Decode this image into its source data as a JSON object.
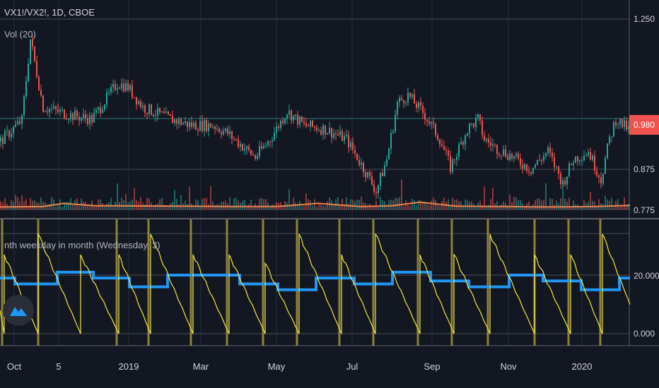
{
  "header": {
    "symbol_title": "VX1!/VX2!, 1D, CBOE",
    "volume_label": "Vol (20)"
  },
  "indicator": {
    "title": "nth weekday in month (Wednesday, 3)"
  },
  "price_axis": {
    "ticks": [
      "1.250",
      "0.875",
      "0.775"
    ],
    "last_price": "0.980"
  },
  "indicator_axis": {
    "ticks": [
      "20.000",
      "0.000"
    ]
  },
  "x_axis": {
    "labels": [
      "Oct",
      "5",
      "2019",
      "Mar",
      "May",
      "Jul",
      "Sep",
      "Nov",
      "2020"
    ]
  },
  "colors": {
    "up": "#26a69a",
    "down": "#ef5350",
    "vol_ma": "#e8844a",
    "saw": "#f5e642",
    "step": "#2196f3",
    "reset": "#b5a642",
    "badge": "#ef5350"
  },
  "chart_data": [
    {
      "type": "candlestick",
      "title": "VX1!/VX2!, 1D, CBOE",
      "ylim": [
        0.76,
        1.29
      ],
      "yticks": [
        1.25,
        0.875,
        0.775
      ],
      "close_anchors": [
        [
          0,
          0.945
        ],
        [
          10,
          0.998
        ],
        [
          14,
          1.2
        ],
        [
          20,
          1.03
        ],
        [
          33,
          1.01
        ],
        [
          43,
          1.0
        ],
        [
          55,
          1.09
        ],
        [
          60,
          1.08
        ],
        [
          67,
          1.03
        ],
        [
          80,
          1.0
        ],
        [
          90,
          0.985
        ],
        [
          100,
          0.985
        ],
        [
          107,
          0.965
        ],
        [
          120,
          0.905
        ],
        [
          127,
          0.95
        ],
        [
          135,
          1.02
        ],
        [
          143,
          0.985
        ],
        [
          153,
          0.975
        ],
        [
          163,
          0.95
        ],
        [
          173,
          0.86
        ],
        [
          177,
          0.82
        ],
        [
          182,
          0.9
        ],
        [
          187,
          1.04
        ],
        [
          192,
          1.06
        ],
        [
          200,
          1.01
        ],
        [
          207,
          0.95
        ],
        [
          212,
          0.88
        ],
        [
          220,
          0.975
        ],
        [
          225,
          1.0
        ],
        [
          228,
          0.95
        ],
        [
          233,
          0.93
        ],
        [
          240,
          0.91
        ],
        [
          250,
          0.875
        ],
        [
          258,
          0.92
        ],
        [
          265,
          0.84
        ],
        [
          270,
          0.9
        ],
        [
          277,
          0.92
        ],
        [
          283,
          0.85
        ],
        [
          287,
          0.95
        ],
        [
          290,
          1.0
        ],
        [
          297,
          0.97
        ]
      ],
      "last_price": 0.98,
      "volume": {
        "label": "Vol (20)",
        "ma_anchors": [
          [
            0,
            0.781
          ],
          [
            20,
            0.782
          ],
          [
            30,
            0.79
          ],
          [
            45,
            0.784
          ],
          [
            90,
            0.783
          ],
          [
            110,
            0.782
          ],
          [
            130,
            0.782
          ],
          [
            150,
            0.79
          ],
          [
            170,
            0.782
          ],
          [
            185,
            0.784
          ],
          [
            198,
            0.793
          ],
          [
            215,
            0.783
          ],
          [
            260,
            0.781
          ],
          [
            280,
            0.782
          ],
          [
            297,
            0.785
          ]
        ]
      }
    },
    {
      "type": "line",
      "title": "nth weekday in month (Wednesday, 3)",
      "ylim": [
        -4,
        38
      ],
      "yticks": [
        20,
        0
      ],
      "reset_markers": [
        1,
        18,
        55,
        70,
        90,
        107,
        124,
        140,
        160,
        176,
        197,
        213,
        230,
        252,
        268,
        283
      ],
      "sawtooth_resets": [
        [
          2,
          27
        ],
        [
          18,
          34
        ],
        [
          38,
          27
        ],
        [
          56,
          27
        ],
        [
          71,
          34
        ],
        [
          91,
          27
        ],
        [
          108,
          27
        ],
        [
          125,
          24
        ],
        [
          141,
          34
        ],
        [
          161,
          27
        ],
        [
          177,
          34
        ],
        [
          198,
          27
        ],
        [
          214,
          27
        ],
        [
          231,
          34
        ],
        [
          252,
          27
        ],
        [
          269,
          27
        ],
        [
          284,
          34
        ]
      ],
      "sawtooth_end": [
        297,
        10
      ],
      "step_series": [
        [
          0,
          19
        ],
        [
          7,
          17
        ],
        [
          27,
          21
        ],
        [
          44,
          19
        ],
        [
          61,
          16
        ],
        [
          79,
          20
        ],
        [
          113,
          17
        ],
        [
          131,
          15
        ],
        [
          149,
          19
        ],
        [
          167,
          17
        ],
        [
          185,
          21
        ],
        [
          203,
          18
        ],
        [
          221,
          16
        ],
        [
          240,
          20
        ],
        [
          256,
          18
        ],
        [
          274,
          15
        ],
        [
          292,
          19
        ],
        [
          297,
          19
        ]
      ]
    }
  ]
}
